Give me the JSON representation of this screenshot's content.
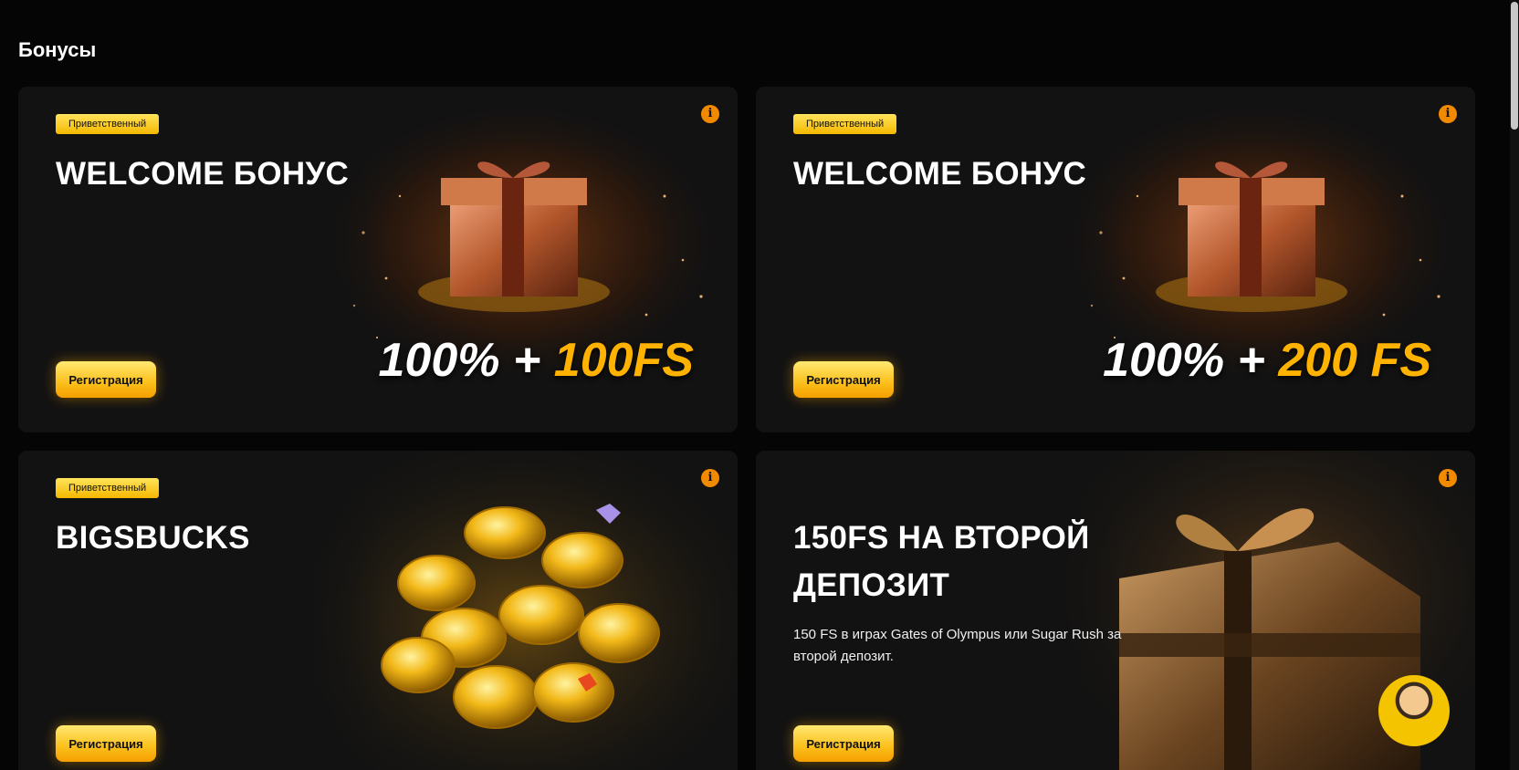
{
  "section": {
    "title": "Бонусы"
  },
  "cards": [
    {
      "badge": "Приветственный",
      "title": "WELCOME БОНУС",
      "description": "",
      "button": "Регистрация",
      "promo_main": "100% + ",
      "promo_accent": "100FS",
      "info_icon": "info-icon",
      "art": "gift-box"
    },
    {
      "badge": "Приветственный",
      "title": "WELCOME БОНУС",
      "description": "",
      "button": "Регистрация",
      "promo_main": "100% + ",
      "promo_accent": "200 FS",
      "info_icon": "info-icon",
      "art": "gift-box"
    },
    {
      "badge": "Приветственный",
      "title": "BIGSBUCKS",
      "description": "",
      "button": "Регистрация",
      "promo_main": "",
      "promo_accent": "",
      "info_icon": "info-icon",
      "art": "gold-coins"
    },
    {
      "badge": "",
      "title": "150FS НА ВТОРОЙ ДЕПОЗИТ",
      "description": "150 FS в играх Gates of Olympus или Sugar Rush за второй депозит.",
      "button": "Регистрация",
      "promo_main": "",
      "promo_accent": "",
      "info_icon": "info-icon",
      "art": "gift-box-dark"
    }
  ],
  "colors": {
    "accent_yellow": "#ffb300",
    "info_orange": "#f28a00",
    "card_bg": "#121212",
    "page_bg": "#050505"
  },
  "chat": {
    "icon": "support-avatar"
  }
}
